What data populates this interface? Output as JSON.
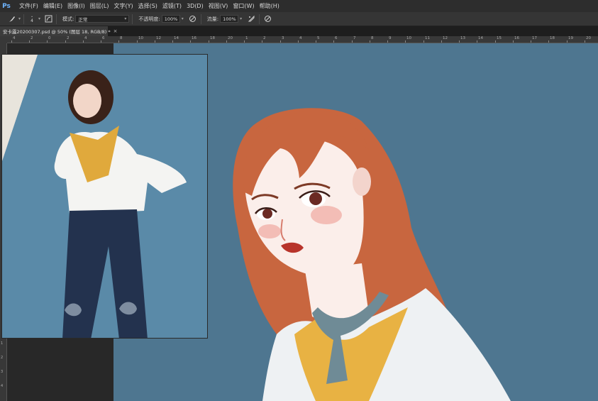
{
  "app": {
    "logo_text": "Ps",
    "menus": [
      "文件(F)",
      "编辑(E)",
      "图像(I)",
      "图层(L)",
      "文字(Y)",
      "选择(S)",
      "滤镜(T)",
      "3D(D)",
      "视图(V)",
      "窗口(W)",
      "帮助(H)"
    ]
  },
  "options_bar": {
    "brush_size": "4",
    "mode_label": "模式:",
    "mode_value": "正常",
    "opacity_label": "不透明度:",
    "opacity_value": "100%",
    "flow_label": "流量:",
    "flow_value": "100%"
  },
  "document_tab": {
    "title": "安卡露20200307.psd @ 50% (图层 18, RGB/8) *",
    "close_glyph": "×"
  },
  "ruler": {
    "top_labels": [
      "4",
      "2",
      "0",
      "2",
      "4",
      "6",
      "8",
      "10",
      "12",
      "14",
      "16",
      "18",
      "20",
      "1",
      "2",
      "3",
      "4",
      "5",
      "6",
      "7",
      "8",
      "9",
      "10",
      "11",
      "12",
      "13",
      "14",
      "15",
      "16",
      "17",
      "18",
      "19",
      "20"
    ],
    "left_labels": [
      "1",
      "2",
      "3",
      "4"
    ]
  },
  "colors": {
    "canvas_bg": "#4e7690",
    "hair": "#c8663f",
    "skin": "#fbeeea",
    "scarf": "#6f8b96",
    "shirt": "#eef1f3",
    "top": "#e8b243"
  },
  "icons": {
    "brush": "brush-icon",
    "brush_panel": "brush-panel-icon",
    "pressure_opacity": "pressure-opacity-icon",
    "airbrush": "airbrush-icon",
    "pressure_size": "pressure-size-icon"
  }
}
